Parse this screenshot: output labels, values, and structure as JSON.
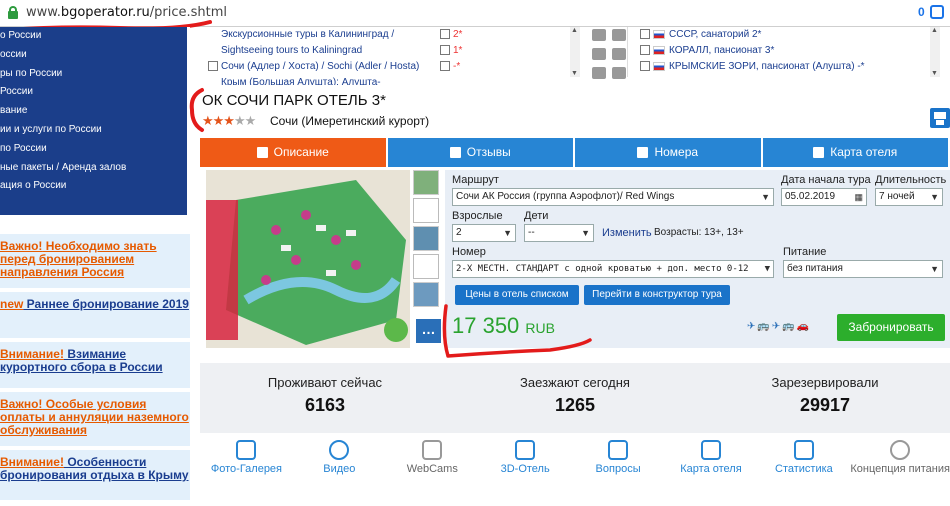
{
  "browser": {
    "url_prefix": "www.",
    "url_host": "bgoperator.ru",
    "url_path": "/price.shtml",
    "badge_count": "0"
  },
  "sidebar": {
    "nav_items": [
      "о России",
      "оссии",
      "ры по России",
      "России",
      "вание",
      "ии и услуги по России",
      "по России",
      "ные пакеты / Аренда залов",
      "ация о России"
    ],
    "notices": [
      {
        "highlight": "Важно!",
        "text": " Необходимо знать перед бронированием направления Россия",
        "link": ""
      },
      {
        "highlight": "new",
        "text": "",
        "link": " Раннее бронирование 2019"
      },
      {
        "highlight": "Внимание!",
        "text": "",
        "link": " Взимание курортного сбора в России"
      },
      {
        "highlight": "Важно!",
        "text": " Особые условия оплаты и аннуляции наземного обслуживания",
        "link": ""
      },
      {
        "highlight": "Внимание!",
        "text": "",
        "link": " Особенности бронирования отдыха в Крыму"
      }
    ]
  },
  "topstrip": {
    "tours": [
      "Экскурсионные туры в Калининград /",
      "Sightseeing tours to Kaliningrad",
      "Сочи (Адлер / Хоста) / Sochi (Adler / Hosta)",
      "Крым (Большая Алушта): Алушта-"
    ],
    "stars_filter": [
      "2*",
      "1*",
      "-*"
    ],
    "hotels": [
      "СССР, санаторий 2*",
      "КОРАЛЛ, пансионат 3*",
      "КРЫМСКИЕ ЗОРИ, пансионат (Алушта) -*"
    ]
  },
  "hotel": {
    "title": "ОК СОЧИ ПАРК ОТЕЛЬ 3*",
    "stars_on": "★★★",
    "stars_off": "★★",
    "rating": 3,
    "location": "Сочи (Имеретинский курорт)"
  },
  "tabs": [
    "Описание",
    "Отзывы",
    "Номера",
    "Карта отеля"
  ],
  "form": {
    "route_label": "Маршрут",
    "route_value": "Сочи АК Россия (группа Аэрофлот)/ Red Wings",
    "start_label": "Дата начала тура",
    "start_value": "05.02.2019",
    "duration_label": "Длительность",
    "duration_value": "7 ночей",
    "adults_label": "Взрослые",
    "adults_value": "2",
    "kids_label": "Дети",
    "kids_value": "--",
    "change_link": "Изменить",
    "ages_text": "Возрасты: 13+, 13+",
    "room_label": "Номер",
    "room_value": "2-Х МЕСТН. СТАНДАРТ с одной кроватью + доп. место 0-12",
    "meal_label": "Питание",
    "meal_value": "без питания",
    "btn_list": "Цены в отель списком",
    "btn_constructor": "Перейти в конструктор тура",
    "price_value": "17 350",
    "price_currency": "RUB",
    "book_button": "Забронировать",
    "transport_icons": "✈🚌✈🚌🚗"
  },
  "stats": [
    {
      "label": "Проживают сейчас",
      "value": "6163"
    },
    {
      "label": "Заезжают сегодня",
      "value": "1265"
    },
    {
      "label": "Зарезервировали",
      "value": "29917"
    }
  ],
  "iconbar": [
    {
      "label": "Фото-Галерея",
      "icon": "camera-icon"
    },
    {
      "label": "Видео",
      "icon": "film-icon"
    },
    {
      "label": "WebCams",
      "icon": "webcam-icon"
    },
    {
      "label": "3D-Отель",
      "icon": "cube-icon"
    },
    {
      "label": "Вопросы",
      "icon": "question-icon"
    },
    {
      "label": "Карта отеля",
      "icon": "map-icon"
    },
    {
      "label": "Статистика",
      "icon": "chart-icon"
    },
    {
      "label": "Концепция питания",
      "icon": "dish-icon"
    }
  ],
  "colors": {
    "primary_blue": "#2785d4",
    "active_orange": "#ef5a16",
    "nav_navy": "#1b3e8a",
    "price_green": "#2aa32f",
    "book_green": "#2cae2c",
    "annotation_red": "#e31b1b"
  }
}
